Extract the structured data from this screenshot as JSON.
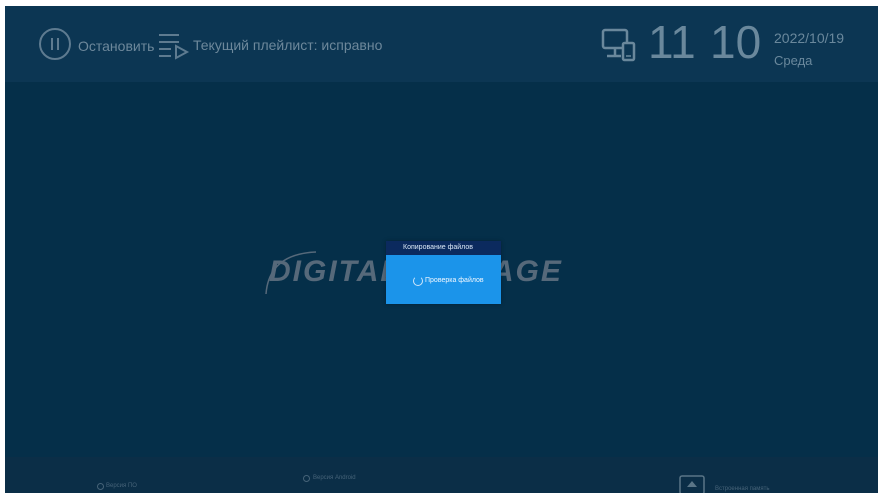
{
  "header": {
    "stop_label": "Остановить",
    "playlist_label": "Текущий плейлист: исправно",
    "clock_hour": "11",
    "clock_minute": "10",
    "date": "2022/10/19",
    "weekday": "Среда"
  },
  "logo": {
    "text": "DIGITAL SIGNAGE"
  },
  "dialog": {
    "title": "Копирование файлов",
    "status": "Проверка файлов"
  },
  "footer": {
    "software_version_label": "Версия ПО",
    "android_version_label": "Версия Android",
    "storage_label": "Встроенная память"
  },
  "colors": {
    "background": "#052f49",
    "topbar": "#0c3653",
    "dialog": "#1b94ea",
    "dialog_title": "#0b2a5e"
  },
  "icons": [
    "pause-icon",
    "playlist-icon",
    "device-icon",
    "spinner-icon",
    "storage-icon"
  ]
}
